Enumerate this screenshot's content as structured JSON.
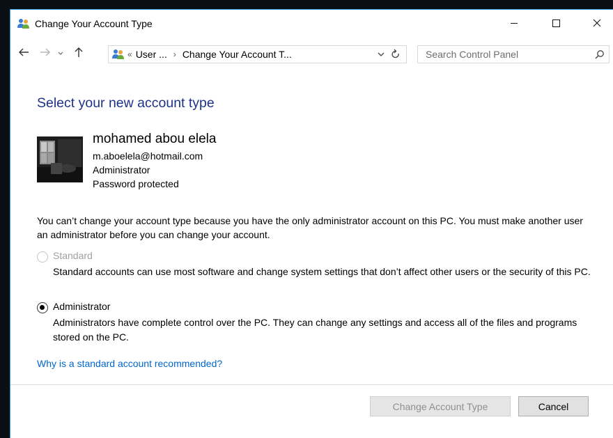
{
  "window": {
    "title": "Change Your Account Type",
    "accent_color": "#2b9fd9"
  },
  "titlebar_icons": {
    "app": "users-icon",
    "minimize": "minimize-icon",
    "maximize": "maximize-icon",
    "close": "close-icon"
  },
  "nav": {
    "back_icon": "arrow-left-icon",
    "forward_icon": "arrow-right-icon",
    "recent_icon": "chevron-down-icon",
    "up_icon": "arrow-up-icon",
    "breadcrumb_overflow": "«",
    "breadcrumb_1": "User ...",
    "breadcrumb_sep": "›",
    "breadcrumb_2": "Change Your Account T...",
    "dropdown_icon": "chevron-down-icon",
    "refresh_icon": "refresh-icon",
    "search_placeholder": "Search Control Panel",
    "search_icon": "search-icon"
  },
  "main": {
    "heading": "Select your new account type",
    "user": {
      "name": "mohamed abou elela",
      "email": "m.aboelela@hotmail.com",
      "role": "Administrator",
      "password_status": "Password protected"
    },
    "warning": "You can’t change your account type because you have the only administrator account on this PC. You must make another user an administrator before you can change your account.",
    "options": [
      {
        "label": "Standard",
        "description": "Standard accounts can use most software and change system settings that don’t affect other users or the security of this PC.",
        "selected": false,
        "enabled": false
      },
      {
        "label": "Administrator",
        "description": "Administrators have complete control over the PC. They can change any settings and access all of the files and programs stored on the PC.",
        "selected": true,
        "enabled": true
      }
    ],
    "help_link": "Why is a standard account recommended?"
  },
  "footer": {
    "change_button": "Change Account Type",
    "cancel_button": "Cancel"
  }
}
